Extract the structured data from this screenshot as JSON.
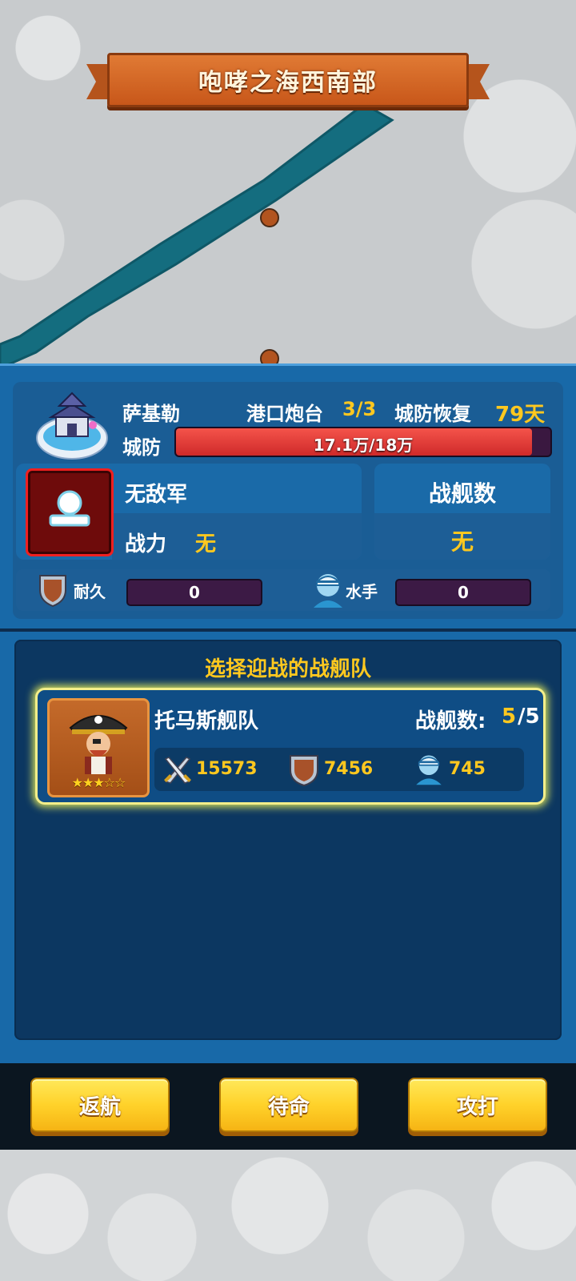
{
  "map": {
    "title": "咆哮之海西南部"
  },
  "town": {
    "name": "萨基勒",
    "port_label": "港口炮台",
    "port_value": "3/3",
    "recover_label": "城防恢复",
    "recover_value": "79天",
    "defense_label": "城防",
    "defense_text": "17.1万/18万",
    "defense_ratio": 0.95
  },
  "enemy": {
    "name": "无敌军",
    "power_label": "战力",
    "power_value": "无",
    "ships_label": "战舰数",
    "ships_value": "无",
    "durability_label": "耐久",
    "durability_value": "0",
    "sailors_label": "水手",
    "sailors_value": "0"
  },
  "fleet_section": {
    "title": "选择迎战的战舰队",
    "fleets": [
      {
        "name": "托马斯舰队",
        "ships_label": "战舰数:",
        "ships_count": "5",
        "ships_total": "/5",
        "stars": "★★★☆☆",
        "attack": "15573",
        "durability": "7456",
        "sailors": "745"
      }
    ]
  },
  "buttons": {
    "return": "返航",
    "standby": "待命",
    "attack": "攻打"
  },
  "colors": {
    "accent_yellow": "#ffc81f",
    "panel_blue": "#1869a8",
    "defense_red": "#e0353a"
  }
}
